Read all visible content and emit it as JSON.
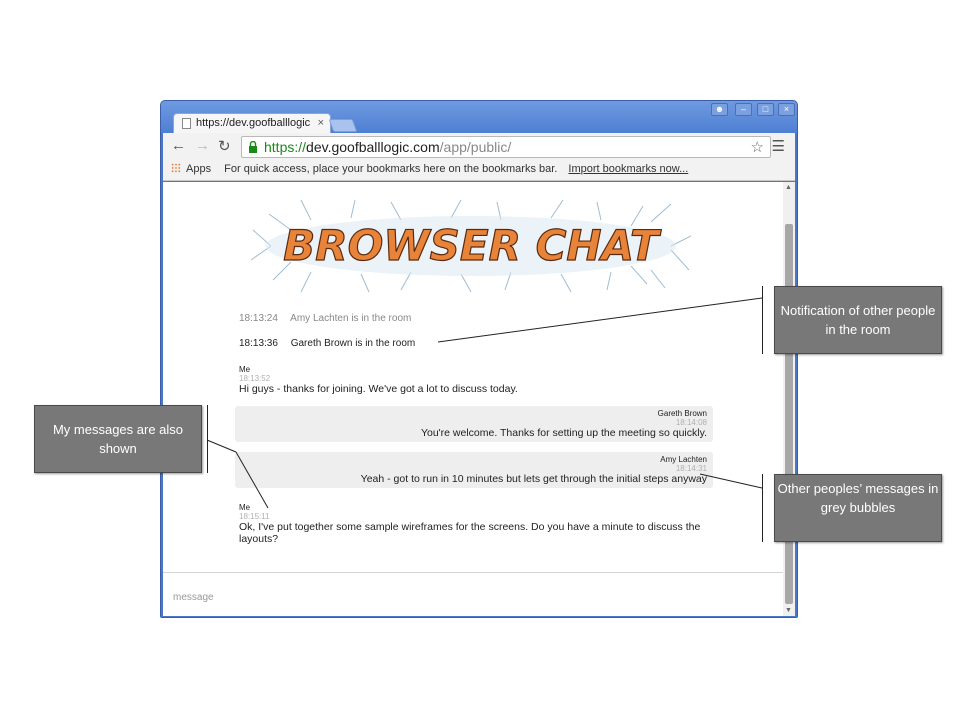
{
  "browser": {
    "tab_title": "https://dev.goofballlogic",
    "tab_close": "×",
    "url": {
      "scheme": "https://",
      "host": "dev.goofballlogic.com",
      "path": "/app/public/"
    },
    "bookmarks": {
      "apps_label": "Apps",
      "hint": "For quick access, place your bookmarks here on the bookmarks bar.",
      "import_link": "Import bookmarks now..."
    },
    "icons": [
      "back-icon",
      "forward-icon",
      "reload-icon",
      "lock-icon",
      "star-icon",
      "menu-icon",
      "user-icon",
      "minimize-icon",
      "maximize-icon",
      "close-icon"
    ]
  },
  "app": {
    "logo_text": "BROWSER CHAT",
    "notifications": [
      {
        "time": "18:13:24",
        "text": "Amy Lachten is in the room"
      },
      {
        "time": "18:13:36",
        "text": "Gareth Brown is in the room"
      }
    ],
    "messages": [
      {
        "sender": "Me",
        "time": "18:13:52",
        "text": "Hi guys - thanks for joining. We've got a lot to discuss today.",
        "mine": true
      },
      {
        "sender": "Gareth Brown",
        "time": "18:14:08",
        "text": "You're welcome. Thanks for setting up the meeting so quickly.",
        "mine": false
      },
      {
        "sender": "Amy Lachten",
        "time": "18:14:31",
        "text": "Yeah - got to run in 10 minutes but lets get through the initial steps anyway",
        "mine": false
      },
      {
        "sender": "Me",
        "time": "18:15:11",
        "text": "Ok, I've put together some sample wireframes for the screens. Do you have a minute to discuss the layouts?",
        "mine": true
      }
    ],
    "input_placeholder": "message"
  },
  "annotations": {
    "notification": "Notification of other people in the room",
    "my_messages": "My messages are also shown",
    "other_messages": "Other peoples’ messages in grey bubbles"
  },
  "colors": {
    "window_frame": "#4a77c9",
    "bubble_bg": "#eeeeee",
    "callout_bg": "#787878",
    "url_https": "#1a8a1a",
    "logo_fill": "#e8843a"
  }
}
